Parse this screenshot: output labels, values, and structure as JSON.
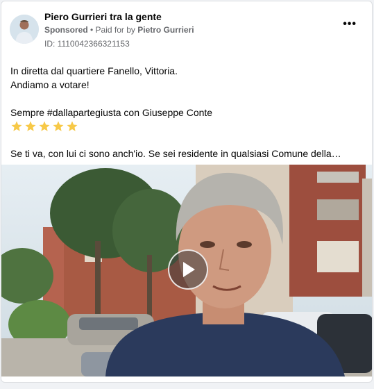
{
  "post": {
    "page_name": "Piero Gurrieri tra la gente",
    "sponsored": "Sponsored",
    "paid_for_prefix": " • Paid for by ",
    "payer": "Pietro Gurrieri",
    "ad_id": "ID: 1110042366321153",
    "more_icon": "more-horizontal-icon",
    "lines": [
      "In diretta dal quartiere Fanello, Vittoria.",
      "Andiamo a votare!",
      "Sempre #dallapartegiusta con Giuseppe Conte",
      "Se ti va, con lui ci sono anch'io. Se sei residente in qualsiasi Comune della…"
    ],
    "star_count": 5,
    "star_color": "#f7c948"
  },
  "video": {
    "play_icon": "play-icon"
  }
}
